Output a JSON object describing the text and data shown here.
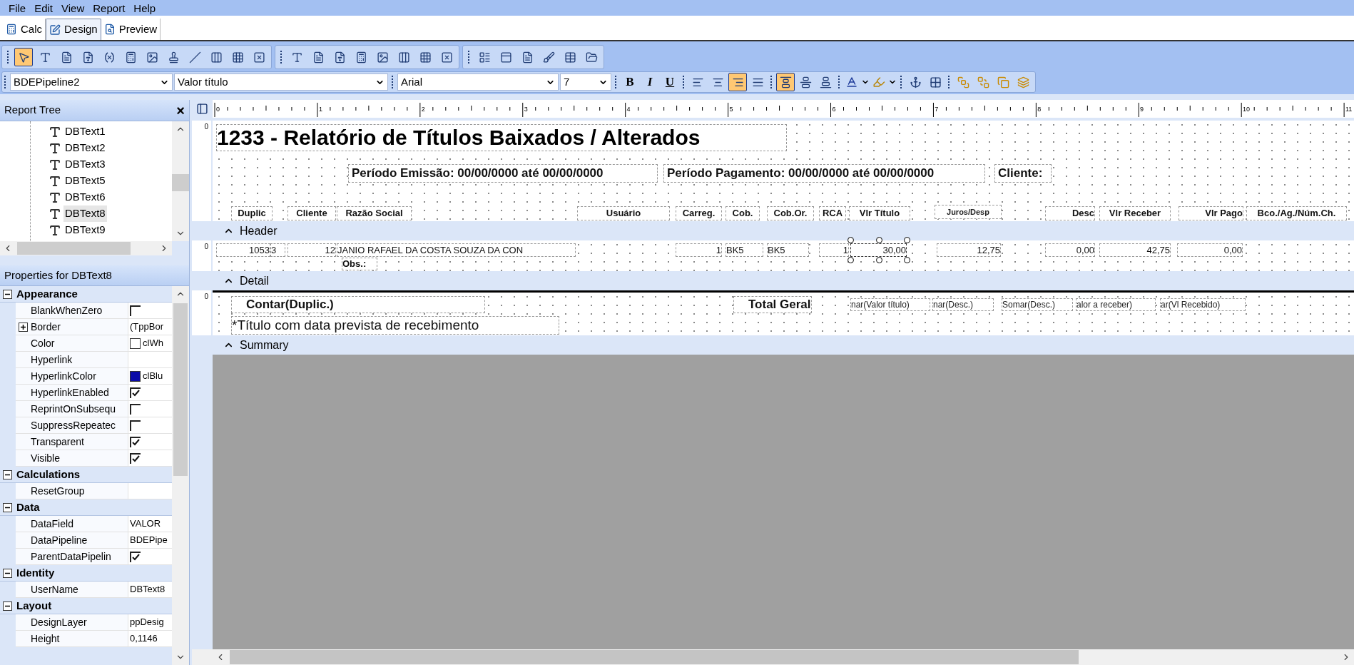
{
  "menu": [
    "File",
    "Edit",
    "View",
    "Report",
    "Help"
  ],
  "tabs": [
    {
      "label": "Calc",
      "kind": "calc",
      "selected": false
    },
    {
      "label": "Design",
      "kind": "design",
      "selected": true
    },
    {
      "label": "Preview",
      "kind": "preview",
      "selected": false
    }
  ],
  "component_toolbar": [
    [
      {
        "kind": "pointer",
        "selected": true
      },
      {
        "kind": "label",
        "selected": false
      },
      {
        "kind": "memo",
        "selected": false
      },
      {
        "kind": "richtext",
        "selected": false
      },
      {
        "kind": "variable",
        "selected": false
      },
      {
        "kind": "calc",
        "selected": false
      },
      {
        "kind": "image",
        "selected": false
      },
      {
        "kind": "stamp",
        "selected": false
      },
      {
        "kind": "line",
        "selected": false
      },
      {
        "kind": "columns",
        "selected": false
      },
      {
        "kind": "grid",
        "selected": false
      },
      {
        "kind": "box",
        "selected": false
      }
    ],
    [
      {
        "kind": "label",
        "selected": false
      },
      {
        "kind": "memo",
        "selected": false
      },
      {
        "kind": "richtext",
        "selected": false
      },
      {
        "kind": "calc",
        "selected": false
      },
      {
        "kind": "image",
        "selected": false
      },
      {
        "kind": "columns",
        "selected": false
      },
      {
        "kind": "grid",
        "selected": false
      },
      {
        "kind": "box",
        "selected": false
      }
    ],
    [
      {
        "kind": "list",
        "selected": false
      },
      {
        "kind": "panel",
        "selected": false
      },
      {
        "kind": "memo",
        "selected": false
      },
      {
        "kind": "brush",
        "selected": false
      },
      {
        "kind": "table",
        "selected": false
      },
      {
        "kind": "folder",
        "selected": false
      }
    ]
  ],
  "format_toolbar": {
    "pipeline": "BDEPipeline2",
    "field": "Valor título",
    "font": "Arial",
    "size": "7",
    "styles": [
      "B",
      "I",
      "U"
    ],
    "align": [
      {
        "kind": "left",
        "selected": false
      },
      {
        "kind": "center",
        "selected": false
      },
      {
        "kind": "right",
        "selected": true
      },
      {
        "kind": "justify",
        "selected": false
      }
    ],
    "valign": [
      {
        "kind": "top",
        "selected": true
      },
      {
        "kind": "middle",
        "selected": false
      },
      {
        "kind": "bottom",
        "selected": false
      }
    ]
  },
  "report_tree": {
    "title": "Report Tree",
    "close": "×",
    "items": [
      {
        "label": "DBText1",
        "selected": false
      },
      {
        "label": "DBText2",
        "selected": false
      },
      {
        "label": "DBText3",
        "selected": false
      },
      {
        "label": "DBText5",
        "selected": false
      },
      {
        "label": "DBText6",
        "selected": false
      },
      {
        "label": "DBText8",
        "selected": true
      },
      {
        "label": "DBText9",
        "selected": false
      }
    ]
  },
  "properties": {
    "title": "Properties for DBText8",
    "groups": [
      {
        "name": "Appearance",
        "expanded": true,
        "properties": [
          {
            "name": "BlankWhenZero",
            "kind": "check",
            "checked": false
          },
          {
            "name": "Border",
            "kind": "sub",
            "expanded": false,
            "value": "(TppBor"
          },
          {
            "name": "Color",
            "kind": "color",
            "color": "#ffffff",
            "value": "clWh"
          },
          {
            "name": "Hyperlink",
            "kind": "text"
          },
          {
            "name": "HyperlinkColor",
            "kind": "color",
            "color": "#0b0ba8",
            "value": "clBlu"
          },
          {
            "name": "HyperlinkEnabled",
            "kind": "check",
            "checked": true
          },
          {
            "name": "ReprintOnSubsequ",
            "kind": "check",
            "checked": false
          },
          {
            "name": "SuppressRepeatec",
            "kind": "check",
            "checked": false
          },
          {
            "name": "Transparent",
            "kind": "check",
            "checked": true
          },
          {
            "name": "Visible",
            "kind": "check",
            "checked": true
          }
        ]
      },
      {
        "name": "Calculations",
        "expanded": true,
        "properties": [
          {
            "name": "ResetGroup",
            "kind": "text"
          }
        ]
      },
      {
        "name": "Data",
        "expanded": true,
        "properties": [
          {
            "name": "DataField",
            "kind": "text",
            "value": "VALOR"
          },
          {
            "name": "DataPipeline",
            "kind": "text",
            "value": "BDEPipe"
          },
          {
            "name": "ParentDataPipelin",
            "kind": "check",
            "checked": true
          }
        ]
      },
      {
        "name": "Identity",
        "expanded": true,
        "properties": [
          {
            "name": "UserName",
            "kind": "text",
            "value": "DBText8"
          }
        ]
      },
      {
        "name": "Layout",
        "expanded": true,
        "properties": [
          {
            "name": "DesignLayer",
            "kind": "text",
            "value": "ppDesig"
          },
          {
            "name": "Height",
            "kind": "text",
            "value": "0,1146"
          }
        ]
      }
    ]
  },
  "ruler": [
    "0",
    "1",
    "2",
    "3",
    "4",
    "5",
    "6",
    "7",
    "8",
    "9",
    "10",
    "11"
  ],
  "bands": [
    {
      "name": "Header",
      "ruler_label": "0",
      "items": [
        {
          "text": "1233 - Relatório de Títulos Baixados / Alterados",
          "kind": "title",
          "selected": false
        },
        {
          "text": "Período Emissão: 00/00/0000 até 00/00/0000",
          "kind": "caption",
          "selected": false
        },
        {
          "text": "Período Pagamento: 00/00/0000 até 00/00/0000",
          "kind": "caption",
          "selected": false
        },
        {
          "text": "Cliente:",
          "kind": "caption",
          "selected": false
        },
        {
          "text": "Duplic",
          "kind": "column",
          "selected": false
        },
        {
          "text": "Cliente",
          "kind": "column",
          "selected": false
        },
        {
          "text": "Razão Social",
          "kind": "column",
          "selected": false
        },
        {
          "text": "Usuário",
          "kind": "column",
          "selected": false
        },
        {
          "text": "Carreg.",
          "kind": "column",
          "selected": false
        },
        {
          "text": "Cob.",
          "kind": "column",
          "selected": false
        },
        {
          "text": "Cob.Or.",
          "kind": "column",
          "selected": false
        },
        {
          "text": "RCA",
          "kind": "column",
          "selected": false
        },
        {
          "text": "Vlr Título",
          "kind": "column",
          "selected": false
        },
        {
          "text": "Juros/Desp",
          "kind": "small",
          "selected": false
        },
        {
          "text": "Desc",
          "kind": "columnright",
          "selected": false
        },
        {
          "text": "Vlr Receber",
          "kind": "column",
          "selected": false
        },
        {
          "text": "Vlr Pago",
          "kind": "columnright",
          "selected": false
        },
        {
          "text": "Bco./Ag./Núm.Ch.",
          "kind": "column",
          "selected": false
        }
      ]
    },
    {
      "name": "Detail",
      "ruler_label": "0",
      "items": [
        {
          "text": "1053",
          "kind": "number",
          "selected": false
        },
        {
          "text": "3",
          "kind": "field",
          "selected": false
        },
        {
          "text": "12",
          "kind": "number",
          "selected": false
        },
        {
          "text": "JANIO RAFAEL DA COSTA SOUZA DA CON",
          "kind": "field",
          "selected": false
        },
        {
          "text": "1",
          "kind": "number",
          "selected": false
        },
        {
          "text": "BK5",
          "kind": "field",
          "selected": false
        },
        {
          "text": "BK5",
          "kind": "field",
          "selected": false
        },
        {
          "text": "1",
          "kind": "number",
          "selected": false
        },
        {
          "text": "30,00",
          "kind": "number",
          "selected": true
        },
        {
          "text": "12,75",
          "kind": "number",
          "selected": false
        },
        {
          "text": "0,00",
          "kind": "number",
          "selected": false
        },
        {
          "text": "42,75",
          "kind": "number",
          "selected": false
        },
        {
          "text": "0,00",
          "kind": "number",
          "selected": false
        },
        {
          "text": "Obs.:",
          "kind": "label",
          "selected": false
        }
      ]
    },
    {
      "name": "Summary",
      "ruler_label": "0",
      "items": [
        {
          "text": "Contar(Duplic.)",
          "kind": "total",
          "selected": false
        },
        {
          "text": "Total Geral",
          "kind": "total",
          "selected": false
        },
        {
          "text": "nar(Valor título)",
          "kind": "calc",
          "selected": false
        },
        {
          "text": "nar(Desc.)",
          "kind": "calc",
          "selected": false
        },
        {
          "text": "Somar(Desc.)",
          "kind": "calc",
          "selected": false
        },
        {
          "text": "alor a receber)",
          "kind": "calc",
          "selected": false
        },
        {
          "text": "ar(Vl Recebido)",
          "kind": "calc",
          "selected": false
        },
        {
          "text": "*Título com data prevista  de recebimento",
          "kind": "note",
          "selected": false
        }
      ]
    }
  ]
}
